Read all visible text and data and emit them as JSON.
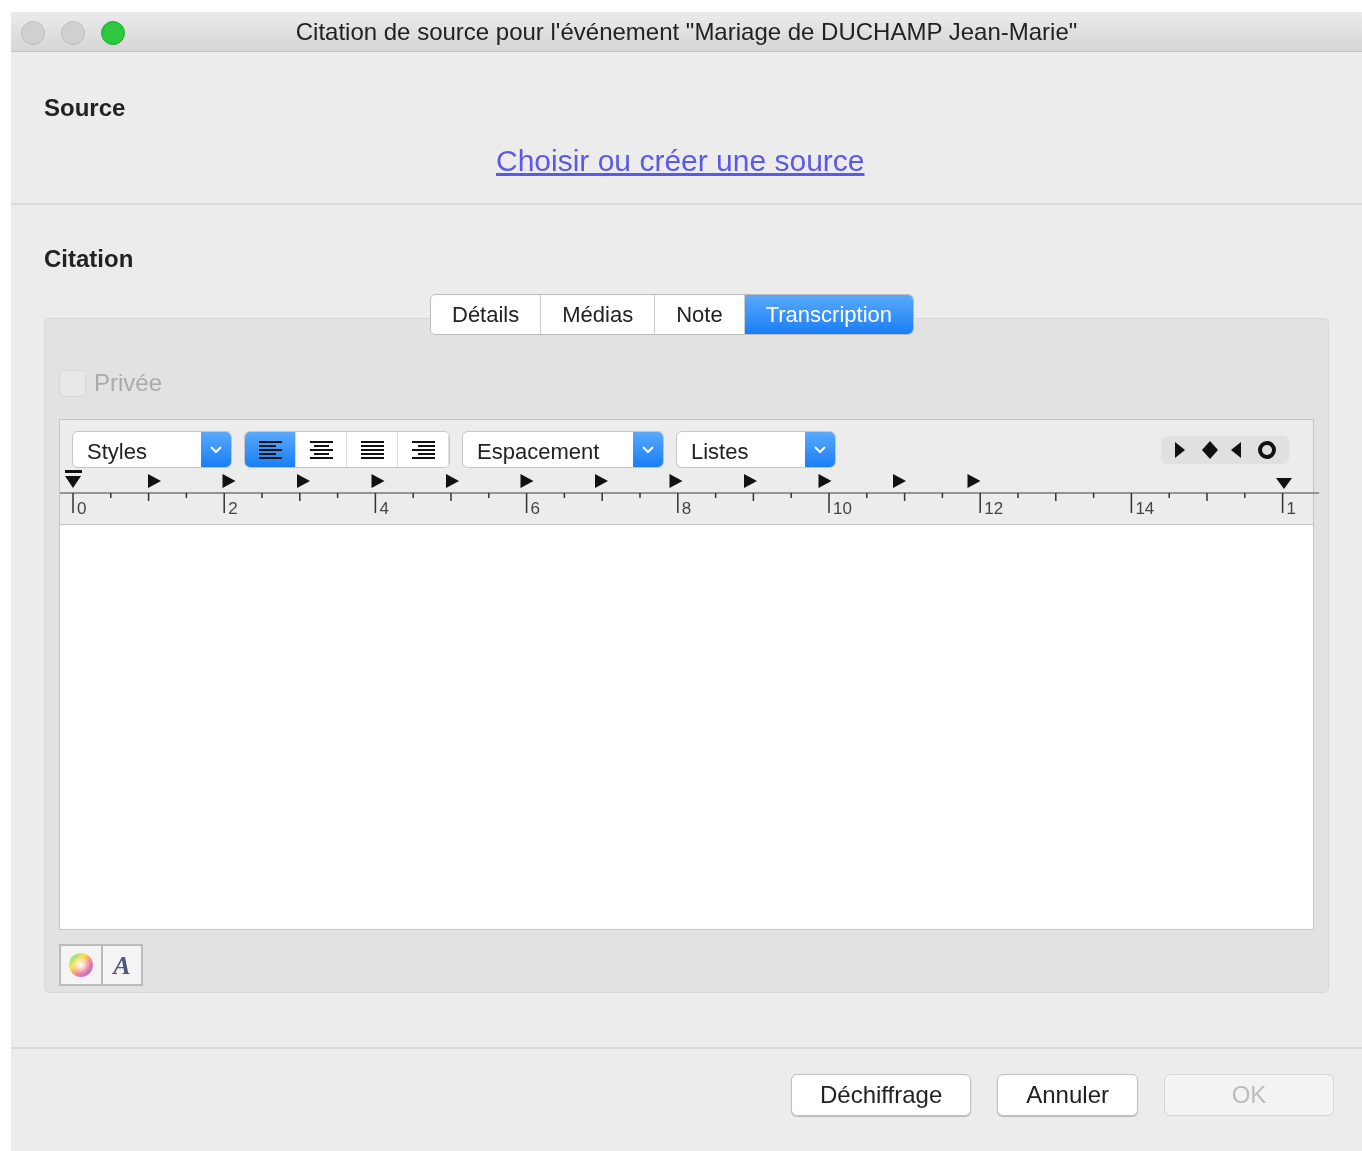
{
  "window": {
    "title": "Citation de source pour l'événement \"Mariage de DUCHAMP Jean-Marie\""
  },
  "source": {
    "heading": "Source",
    "link": "Choisir ou créer une source"
  },
  "citation": {
    "heading": "Citation",
    "tabs": [
      {
        "label": "Détails",
        "selected": false
      },
      {
        "label": "Médias",
        "selected": false
      },
      {
        "label": "Note",
        "selected": false
      },
      {
        "label": "Transcription",
        "selected": true
      }
    ],
    "private_checkbox": {
      "label": "Privée",
      "checked": false,
      "disabled": true
    },
    "toolbar": {
      "styles": "Styles",
      "spacing": "Espacement",
      "lists": "Listes",
      "alignment": [
        {
          "kind": "left",
          "selected": true
        },
        {
          "kind": "center",
          "selected": false
        },
        {
          "kind": "justify",
          "selected": false
        },
        {
          "kind": "right",
          "selected": false
        }
      ]
    },
    "ruler_labels": [
      "0",
      "2",
      "4",
      "6",
      "8",
      "10",
      "12",
      "14",
      "1"
    ],
    "font_button": "A"
  },
  "buttons": [
    {
      "label": "Déchiffrage",
      "disabled": false
    },
    {
      "label": "Annuler",
      "disabled": false
    },
    {
      "label": "OK",
      "disabled": true
    }
  ]
}
